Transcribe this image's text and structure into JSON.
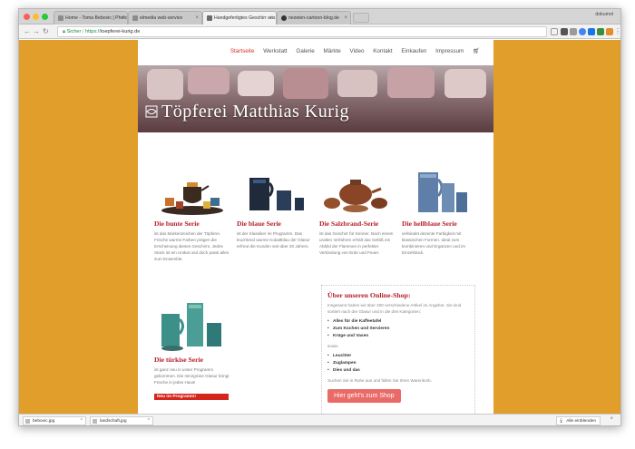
{
  "browser": {
    "tabs": [
      {
        "label": "Home - Toma Bebovic | Photo"
      },
      {
        "label": "elmedia web-service"
      },
      {
        "label": "Handgefertigtes Geschirr aus"
      },
      {
        "label": "nezeien-cartoon-blog.de"
      }
    ],
    "profile": "dokumol",
    "url": {
      "secure": "Sicher",
      "https": "https://",
      "host": "toepferei-kurig.de"
    }
  },
  "site": {
    "nav": [
      "Startseite",
      "Werkstatt",
      "Galerie",
      "Märkte",
      "Video",
      "Kontakt",
      "Einkaufen",
      "Impressum"
    ],
    "cart_icon": "cart-icon",
    "banner_title": "Töpferei Matthias Kurig"
  },
  "series": [
    {
      "title": "Die bunte Serie",
      "text": "ist das Markenzeichen der Töpferei. Frische warme Farben prägen die Erscheinung dieses Geschirrs. Jedes Stück ist ein Unikat und doch passt alles zum Ensemble."
    },
    {
      "title": "Die blaue Serie",
      "text": "ist der Klassiker im Programm. Das leuchtend warme Kobaltblau der Glasur erfreut die Kunden seit über 20 Jahren."
    },
    {
      "title": "Die Salzbrand-Serie",
      "text": "ist das Geschirr für Kenner. Nach einem uralten Verfahren erhält das Gefäß ein Abbild der Flammen in perfekter Verbindung von Erde und Feuer."
    },
    {
      "title": "Die hellblaue Serie",
      "text": "verbindet dezente Farbigkeit mit klassischen Formen. Ideal zum kombinieren und Ergänzen und im Einzelstück."
    },
    {
      "title": "Die türkise Serie",
      "text": "ist ganz neu in unser Programm gekommen. Die minzgrüne Glasur bringt Frische in jedes Haus!",
      "badge": "Neu im Programm!"
    }
  ],
  "shop": {
    "title": "Über unseren Online-Shop:",
    "intro": "Insgesamt haben wir über 200 verschiedene Artikel im Angebot. Sie sind sortiert nach der Glasur und in die drei Kategorien:",
    "categories": [
      "Alles für die Kaffeetafel",
      "Zum Kochen und Servieren",
      "Krüge und Vasen"
    ],
    "sowie": "sowie",
    "extras": [
      "Leuchter",
      "Zuglampen",
      "Dies und das"
    ],
    "outro": "Suchen Sie in Ruhe aus und füllen Sie Ihren Warenkorb.",
    "button": "Hier geht's zum Shop"
  },
  "downloads": {
    "items": [
      {
        "name": "bebovic.jpg"
      },
      {
        "name": "landschaft.jpg"
      }
    ],
    "show_all": "Alle einblenden"
  },
  "colors": {
    "background": "#e19e2a",
    "accent": "#b5202a",
    "nav_active": "#d4341f",
    "shop_button": "#e96a66"
  }
}
